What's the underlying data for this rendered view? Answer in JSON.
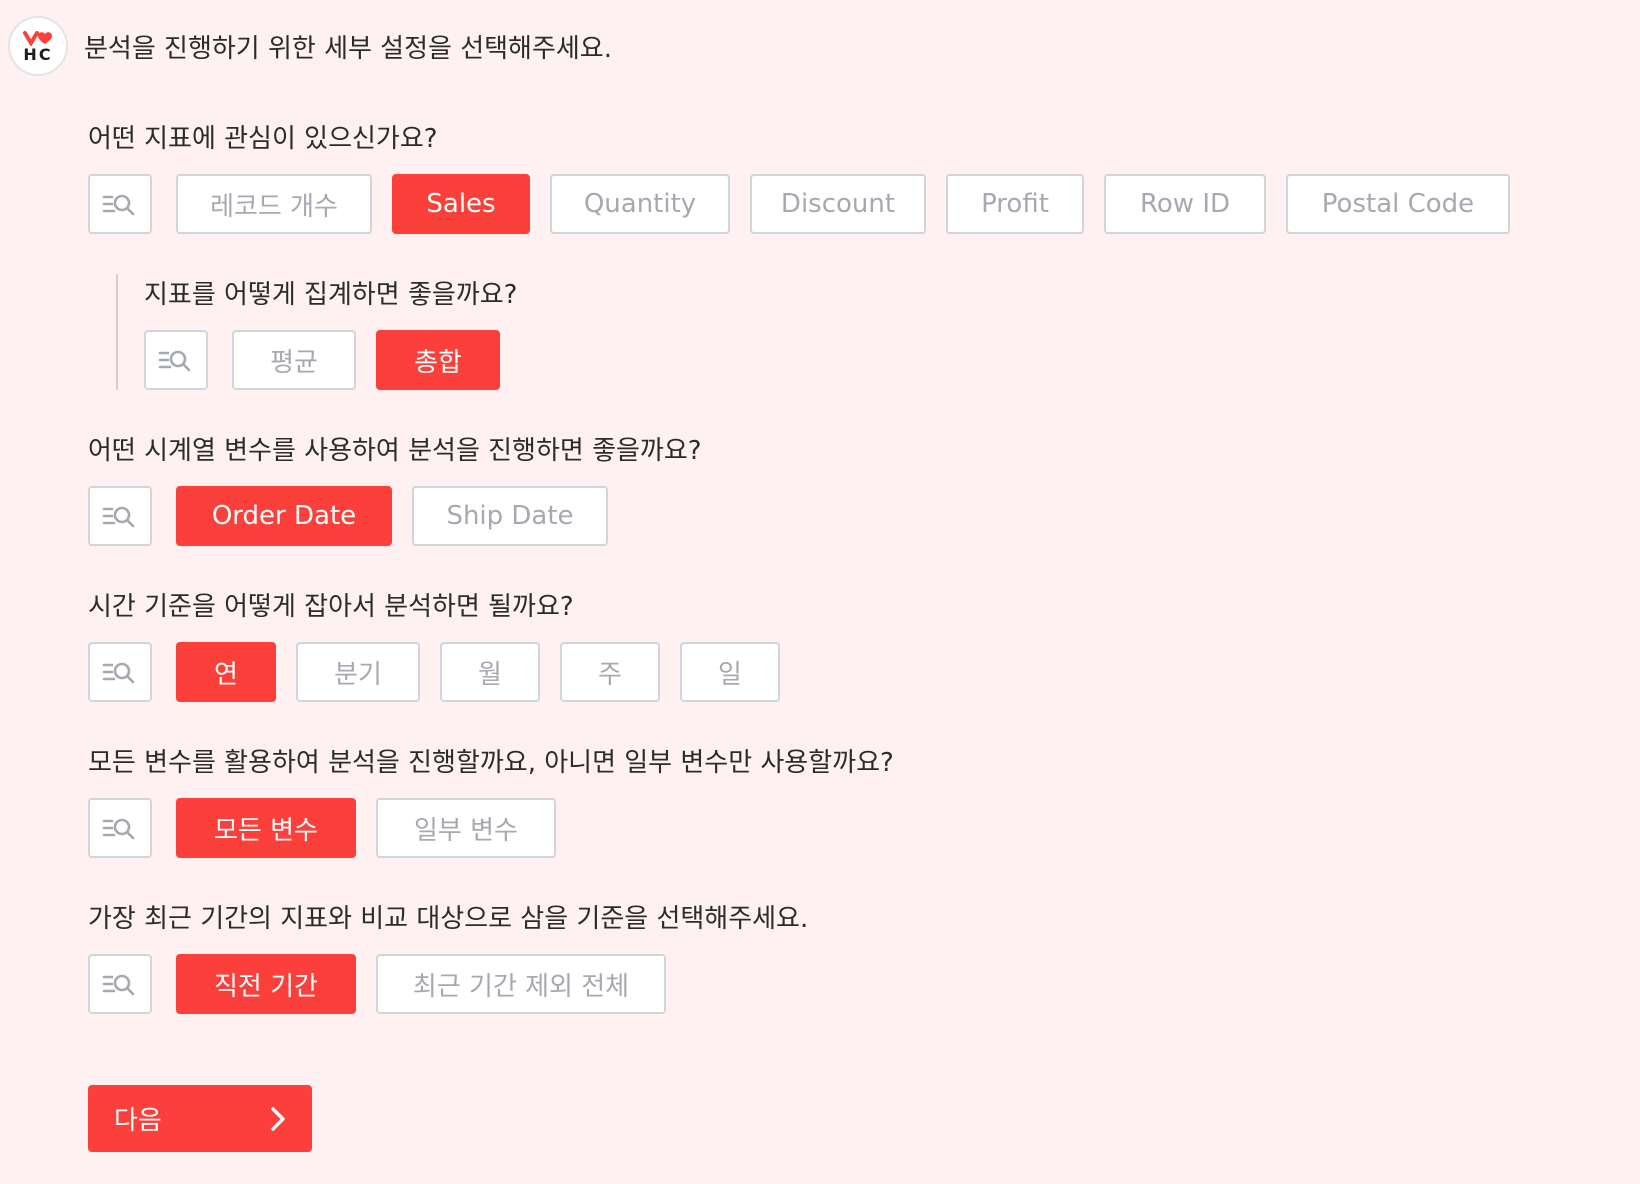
{
  "header": {
    "logo_text": "HC",
    "message": "분석을 진행하기 위한 세부 설정을 선택해주세요."
  },
  "questions": {
    "metric": {
      "label": "어떤 지표에 관심이 있으신가요?",
      "options": [
        "레코드 개수",
        "Sales",
        "Quantity",
        "Discount",
        "Profit",
        "Row ID",
        "Postal Code"
      ],
      "selected": "Sales"
    },
    "aggregation": {
      "label": "지표를 어떻게 집계하면 좋을까요?",
      "options": [
        "평균",
        "총합"
      ],
      "selected": "총합"
    },
    "time_var": {
      "label": "어떤 시계열 변수를 사용하여 분석을 진행하면 좋을까요?",
      "options": [
        "Order Date",
        "Ship Date"
      ],
      "selected": "Order Date"
    },
    "time_unit": {
      "label": "시간 기준을 어떻게 잡아서 분석하면 될까요?",
      "options": [
        "연",
        "분기",
        "월",
        "주",
        "일"
      ],
      "selected": "연"
    },
    "variables": {
      "label": "모든 변수를 활용하여 분석을 진행할까요, 아니면 일부 변수만 사용할까요?",
      "options": [
        "모든 변수",
        "일부 변수"
      ],
      "selected": "모든 변수"
    },
    "comparison": {
      "label": "가장 최근 기간의 지표와 비교 대상으로 삼을 기준을 선택해주세요.",
      "options": [
        "직전 기간",
        "최근 기간 제외 전체"
      ],
      "selected": "직전 기간"
    }
  },
  "next_button": {
    "label": "다음"
  },
  "icons": {
    "search": "list-search-icon",
    "next": "chevron-right-icon"
  },
  "colors": {
    "accent": "#fb3f3a",
    "background": "#fff1f1",
    "border": "#d2d4da",
    "muted_text": "#a7a9b0"
  }
}
